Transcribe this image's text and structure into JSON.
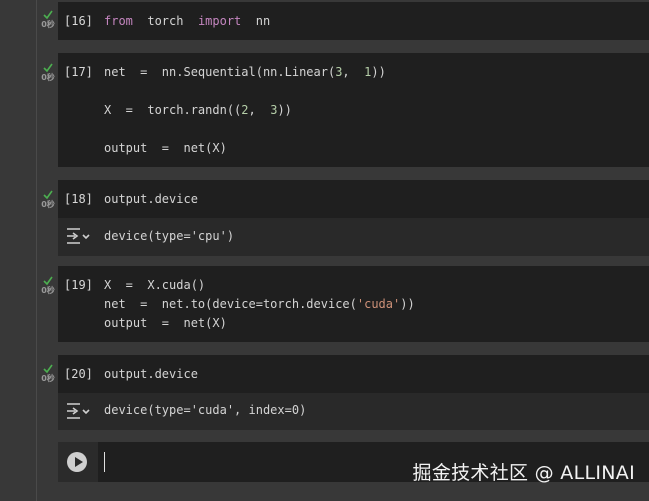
{
  "cells": [
    {
      "number": "[16]",
      "time": "0秒",
      "lines": [
        [
          "from",
          "torch",
          "import",
          "nn"
        ]
      ]
    },
    {
      "number": "[17]",
      "time": "0秒"
    },
    {
      "number": "[18]",
      "time": "0秒",
      "output": "device(type='cpu')"
    },
    {
      "number": "[19]",
      "time": "0秒"
    },
    {
      "number": "[20]",
      "time": "0秒",
      "output": "device(type='cuda', index=0)"
    }
  ],
  "code": {
    "c16": {
      "kw_from": "from",
      "torch": "torch",
      "kw_import": "import",
      "nn": "nn"
    },
    "c17": {
      "l1a": "net  =  nn.Sequential(nn.Linear(",
      "l1n1": "3",
      "l1b": ",  ",
      "l1n2": "1",
      "l1c": "))",
      "l2a": "X  =  torch.randn((",
      "l2n1": "2",
      "l2b": ",  ",
      "l2n2": "3",
      "l2c": "))",
      "l3a": "output  =  net(X)"
    },
    "c18": {
      "l1": "output.device"
    },
    "c19": {
      "l1": "X  =  X.cuda()",
      "l2a": "net  =  net.to(device=torch.device(",
      "l2s": "'cuda'",
      "l2b": "))",
      "l3": "output  =  net(X)"
    },
    "c20": {
      "l1": "output.device"
    }
  },
  "icons": {
    "status": "check-icon",
    "output": "output-toggle-icon",
    "run": "play-icon"
  },
  "colors": {
    "check": "#4caf50",
    "keyword": "#c586c0"
  },
  "watermark": "掘金技术社区 @ ALLINAI"
}
